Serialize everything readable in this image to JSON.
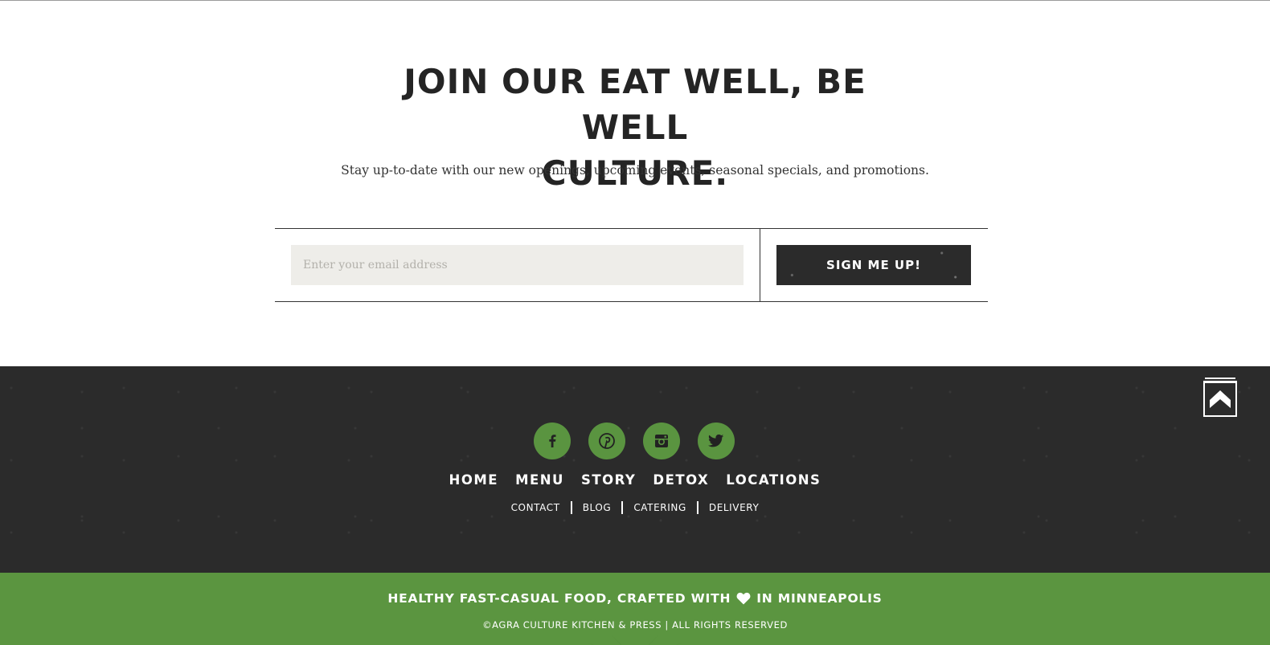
{
  "signup": {
    "headline_line1": "JOIN OUR EAT WELL, BE WELL",
    "headline_line2": "CULTURE.",
    "subtext": "Stay up-to-date with our new openings, upcoming events, seasonal specials, and promotions.",
    "email_placeholder": "Enter your email address",
    "email_value": "",
    "submit_label": "SIGN ME UP!"
  },
  "footer": {
    "social": [
      {
        "name": "facebook-icon",
        "glyph": "f"
      },
      {
        "name": "pinterest-icon",
        "glyph": "p"
      },
      {
        "name": "instagram-icon",
        "glyph": "ig"
      },
      {
        "name": "twitter-icon",
        "glyph": "tw"
      }
    ],
    "main_nav": [
      "HOME",
      "MENU",
      "STORY",
      "DETOX",
      "LOCATIONS"
    ],
    "sub_nav": [
      "CONTACT",
      "BLOG",
      "CATERING",
      "DELIVERY"
    ],
    "tagline_before": "HEALTHY FAST-CASUAL FOOD, CRAFTED WITH",
    "tagline_after": "IN MINNEAPOLIS",
    "copyright": "©AGRA CULTURE KITCHEN & PRESS | ALL RIGHTS RESERVED"
  },
  "colors": {
    "dark": "#2b2b2b",
    "green": "#5b9540",
    "social_green": "#5a9440",
    "input_bg": "#eeede9"
  }
}
